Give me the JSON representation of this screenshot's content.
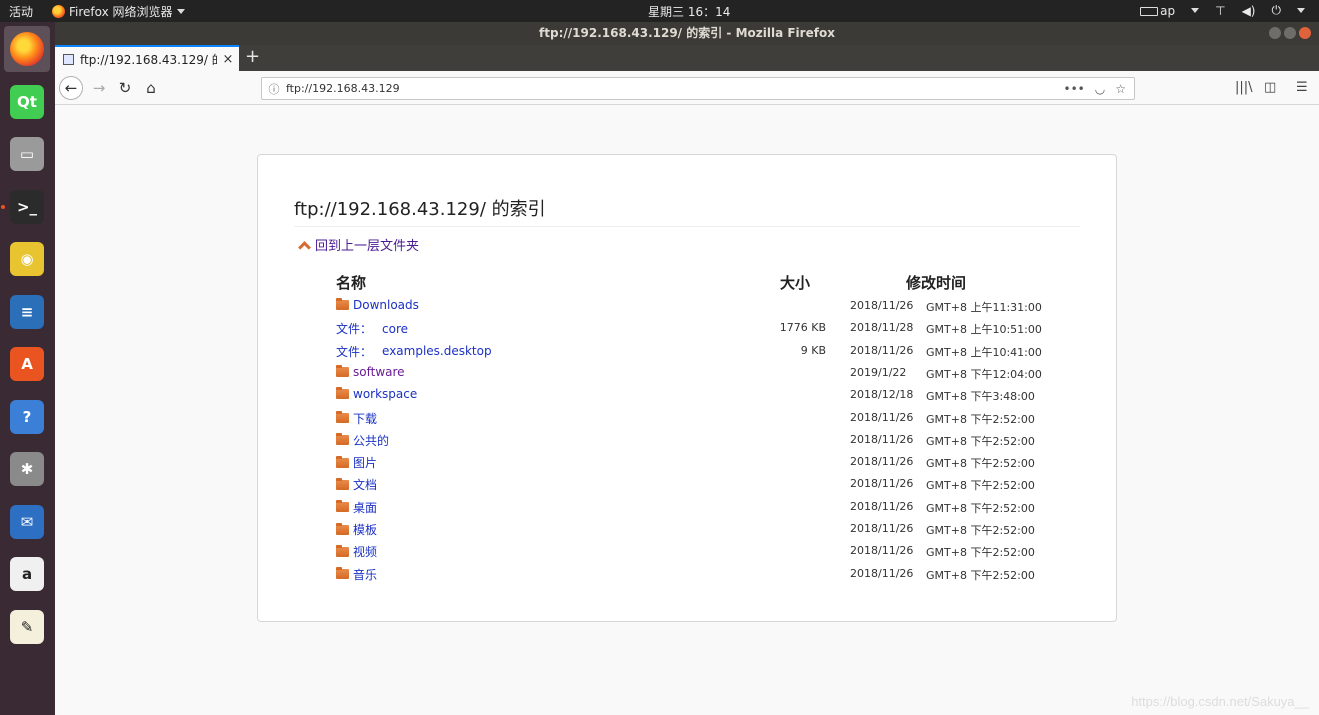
{
  "top_panel": {
    "activities": "活动",
    "app_menu": "Firefox 网络浏览器",
    "clock": "星期三 16：14",
    "input_method": "ap"
  },
  "window": {
    "title": "ftp://192.168.43.129/ 的索引 - Mozilla Firefox"
  },
  "tab": {
    "title": "ftp://192.168.43.129/ 的",
    "close": "×",
    "new_tab": "+"
  },
  "nav": {
    "url": "ftp://192.168.43.129",
    "back": "←",
    "forward": "→",
    "reload": "↻",
    "home": "⌂",
    "more": "•••",
    "bookmark": "☆",
    "library": "|||\\",
    "menu": "☰"
  },
  "listing": {
    "title": "ftp://192.168.43.129/ 的索引",
    "up_link": "回到上一层文件夹",
    "headers": {
      "name": "名称",
      "size": "大小",
      "modified": "修改时间"
    },
    "file_prefix": "文件：",
    "rows": [
      {
        "type": "folder",
        "name": "Downloads",
        "size": "",
        "date": "2018/11/26",
        "time": "GMT+8 上午11:31:00",
        "visited": false
      },
      {
        "type": "file",
        "name": "core",
        "size": "1776 KB",
        "date": "2018/11/28",
        "time": "GMT+8 上午10:51:00",
        "visited": false
      },
      {
        "type": "file",
        "name": "examples.desktop",
        "size": "9 KB",
        "date": "2018/11/26",
        "time": "GMT+8 上午10:41:00",
        "visited": false
      },
      {
        "type": "folder",
        "name": "software",
        "size": "",
        "date": "2019/1/22",
        "time": "GMT+8 下午12:04:00",
        "visited": true
      },
      {
        "type": "folder",
        "name": "workspace",
        "size": "",
        "date": "2018/12/18",
        "time": "GMT+8 下午3:48:00",
        "visited": false
      },
      {
        "type": "folder",
        "name": "下载",
        "size": "",
        "date": "2018/11/26",
        "time": "GMT+8 下午2:52:00",
        "visited": false
      },
      {
        "type": "folder",
        "name": "公共的",
        "size": "",
        "date": "2018/11/26",
        "time": "GMT+8 下午2:52:00",
        "visited": false
      },
      {
        "type": "folder",
        "name": "图片",
        "size": "",
        "date": "2018/11/26",
        "time": "GMT+8 下午2:52:00",
        "visited": false
      },
      {
        "type": "folder",
        "name": "文档",
        "size": "",
        "date": "2018/11/26",
        "time": "GMT+8 下午2:52:00",
        "visited": false
      },
      {
        "type": "folder",
        "name": "桌面",
        "size": "",
        "date": "2018/11/26",
        "time": "GMT+8 下午2:52:00",
        "visited": false
      },
      {
        "type": "folder",
        "name": "模板",
        "size": "",
        "date": "2018/11/26",
        "time": "GMT+8 下午2:52:00",
        "visited": false
      },
      {
        "type": "folder",
        "name": "视频",
        "size": "",
        "date": "2018/11/26",
        "time": "GMT+8 下午2:52:00",
        "visited": false
      },
      {
        "type": "folder",
        "name": "音乐",
        "size": "",
        "date": "2018/11/26",
        "time": "GMT+8 下午2:52:00",
        "visited": false
      }
    ]
  },
  "launcher": {
    "items": [
      {
        "name": "firefox-icon",
        "glyph": "",
        "color": "#ff7a1a"
      },
      {
        "name": "qt-creator-icon",
        "glyph": "Qt",
        "color": "#41cd52"
      },
      {
        "name": "file-manager-icon",
        "glyph": "▭",
        "color": "#9a9a9a"
      },
      {
        "name": "terminal-icon",
        "glyph": ">_",
        "color": "#2b2b2b"
      },
      {
        "name": "rhythmbox-icon",
        "glyph": "◉",
        "color": "#e8c430"
      },
      {
        "name": "libreoffice-writer-icon",
        "glyph": "≡",
        "color": "#2a6fb8"
      },
      {
        "name": "software-center-icon",
        "glyph": "A",
        "color": "#e95420"
      },
      {
        "name": "help-icon",
        "glyph": "?",
        "color": "#3b80d6"
      },
      {
        "name": "settings-icon",
        "glyph": "✱",
        "color": "#8a8a8a"
      },
      {
        "name": "thunderbird-icon",
        "glyph": "✉",
        "color": "#2d6fc2"
      },
      {
        "name": "amazon-icon",
        "glyph": "a",
        "color": "#f0f0f0"
      },
      {
        "name": "text-editor-icon",
        "glyph": "✎",
        "color": "#f5f0dc"
      }
    ]
  },
  "watermark": "https://blog.csdn.net/Sakuya__"
}
